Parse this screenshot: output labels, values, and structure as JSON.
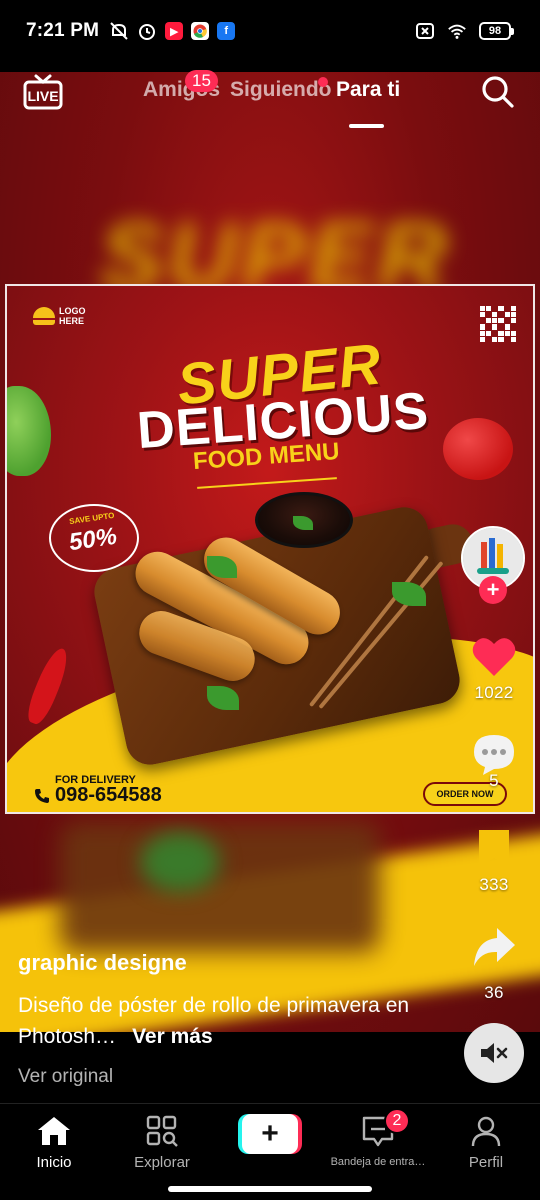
{
  "status_bar": {
    "time": "7:21 PM",
    "battery": "98",
    "left_icons": [
      "mute-icon",
      "alarm-icon",
      "youtube-icon",
      "chrome-icon",
      "facebook-icon"
    ],
    "right_icons": [
      "sim-icon",
      "wifi-icon",
      "battery-icon"
    ]
  },
  "top_nav": {
    "live_label": "LIVE",
    "tabs": [
      {
        "label": "Amigos",
        "badge": "15"
      },
      {
        "label": "Siguiendo",
        "dot": true
      },
      {
        "label": "Para ti",
        "active": true
      }
    ]
  },
  "poster": {
    "logo": "LOGO HERE",
    "headline_1": "SUPER",
    "headline_2": "DELICIOUS",
    "headline_3": "FOOD MENU",
    "save_small": "SAVE UPTO",
    "save_pct": "50%",
    "delivery_label": "FOR DELIVERY",
    "delivery_phone": "098-654588",
    "order_button": "ORDER NOW"
  },
  "actions": {
    "likes": "1022",
    "comments": "5",
    "saves": "333",
    "shares": "36"
  },
  "caption": {
    "username": "graphic designe",
    "description": "Diseño de póster de rollo de primavera en Photosh…",
    "see_more": "Ver más",
    "original": "Ver original"
  },
  "bottom_nav": {
    "items": [
      {
        "label": "Inicio",
        "active": true
      },
      {
        "label": "Explorar"
      },
      {
        "label": "Bandeja de entra…",
        "badge": "2"
      },
      {
        "label": "Perfil"
      }
    ]
  },
  "colors": {
    "accent": "#fe2c55",
    "cyan": "#25f4ee",
    "poster_red": "#9e1316",
    "poster_yellow": "#f7c70e"
  }
}
